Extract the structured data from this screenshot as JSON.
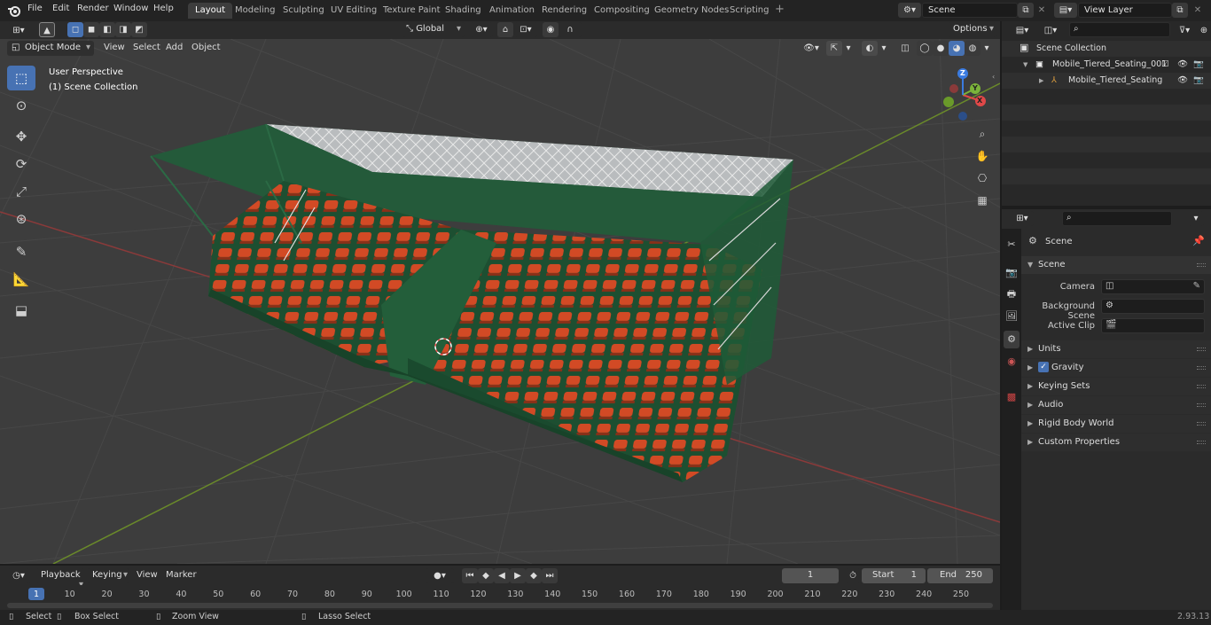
{
  "menu": [
    "File",
    "Edit",
    "Render",
    "Window",
    "Help"
  ],
  "workspaces": [
    "Layout",
    "Modeling",
    "Sculpting",
    "UV Editing",
    "Texture Paint",
    "Shading",
    "Animation",
    "Rendering",
    "Compositing",
    "Geometry Nodes",
    "Scripting"
  ],
  "active_workspace": "Layout",
  "scene_field": "Scene",
  "view_layer_field": "View Layer",
  "header": {
    "orientation": "Global",
    "options": "Options",
    "mode": "Object Mode",
    "menus": [
      "View",
      "Select",
      "Add",
      "Object"
    ]
  },
  "viewport": {
    "perspective": "User Perspective",
    "collection": "(1) Scene Collection",
    "gizmo_axes": [
      "X",
      "Y",
      "Z"
    ]
  },
  "outliner": {
    "root": "Scene Collection",
    "items": [
      "Mobile_Tiered_Seating_001",
      "Mobile_Tiered_Seating"
    ]
  },
  "properties": {
    "context": "Scene",
    "panel": "Scene",
    "fields": [
      "Camera",
      "Background Scene",
      "Active Clip"
    ],
    "subpanels": [
      "Units",
      "Gravity",
      "Keying Sets",
      "Audio",
      "Rigid Body World",
      "Custom Properties"
    ],
    "gravity_checked": true
  },
  "timeline": {
    "menus": [
      "Playback",
      "Keying",
      "View",
      "Marker"
    ],
    "current_frame": "1",
    "start_label": "Start",
    "start": "1",
    "end_label": "End",
    "end": "250",
    "ruler": [
      "1",
      "10",
      "20",
      "30",
      "40",
      "50",
      "60",
      "70",
      "80",
      "90",
      "100",
      "110",
      "120",
      "130",
      "140",
      "150",
      "160",
      "170",
      "180",
      "190",
      "200",
      "210",
      "220",
      "230",
      "240",
      "250"
    ]
  },
  "status": {
    "select": "Select",
    "box_select": "Box Select",
    "zoom_view": "Zoom View",
    "lasso_select": "Lasso Select",
    "version": "2.93.13"
  },
  "colors": {
    "accent": "#4772b3",
    "seat": "#d24a25",
    "frame": "#1e5a36",
    "roof": "#245a3a"
  }
}
